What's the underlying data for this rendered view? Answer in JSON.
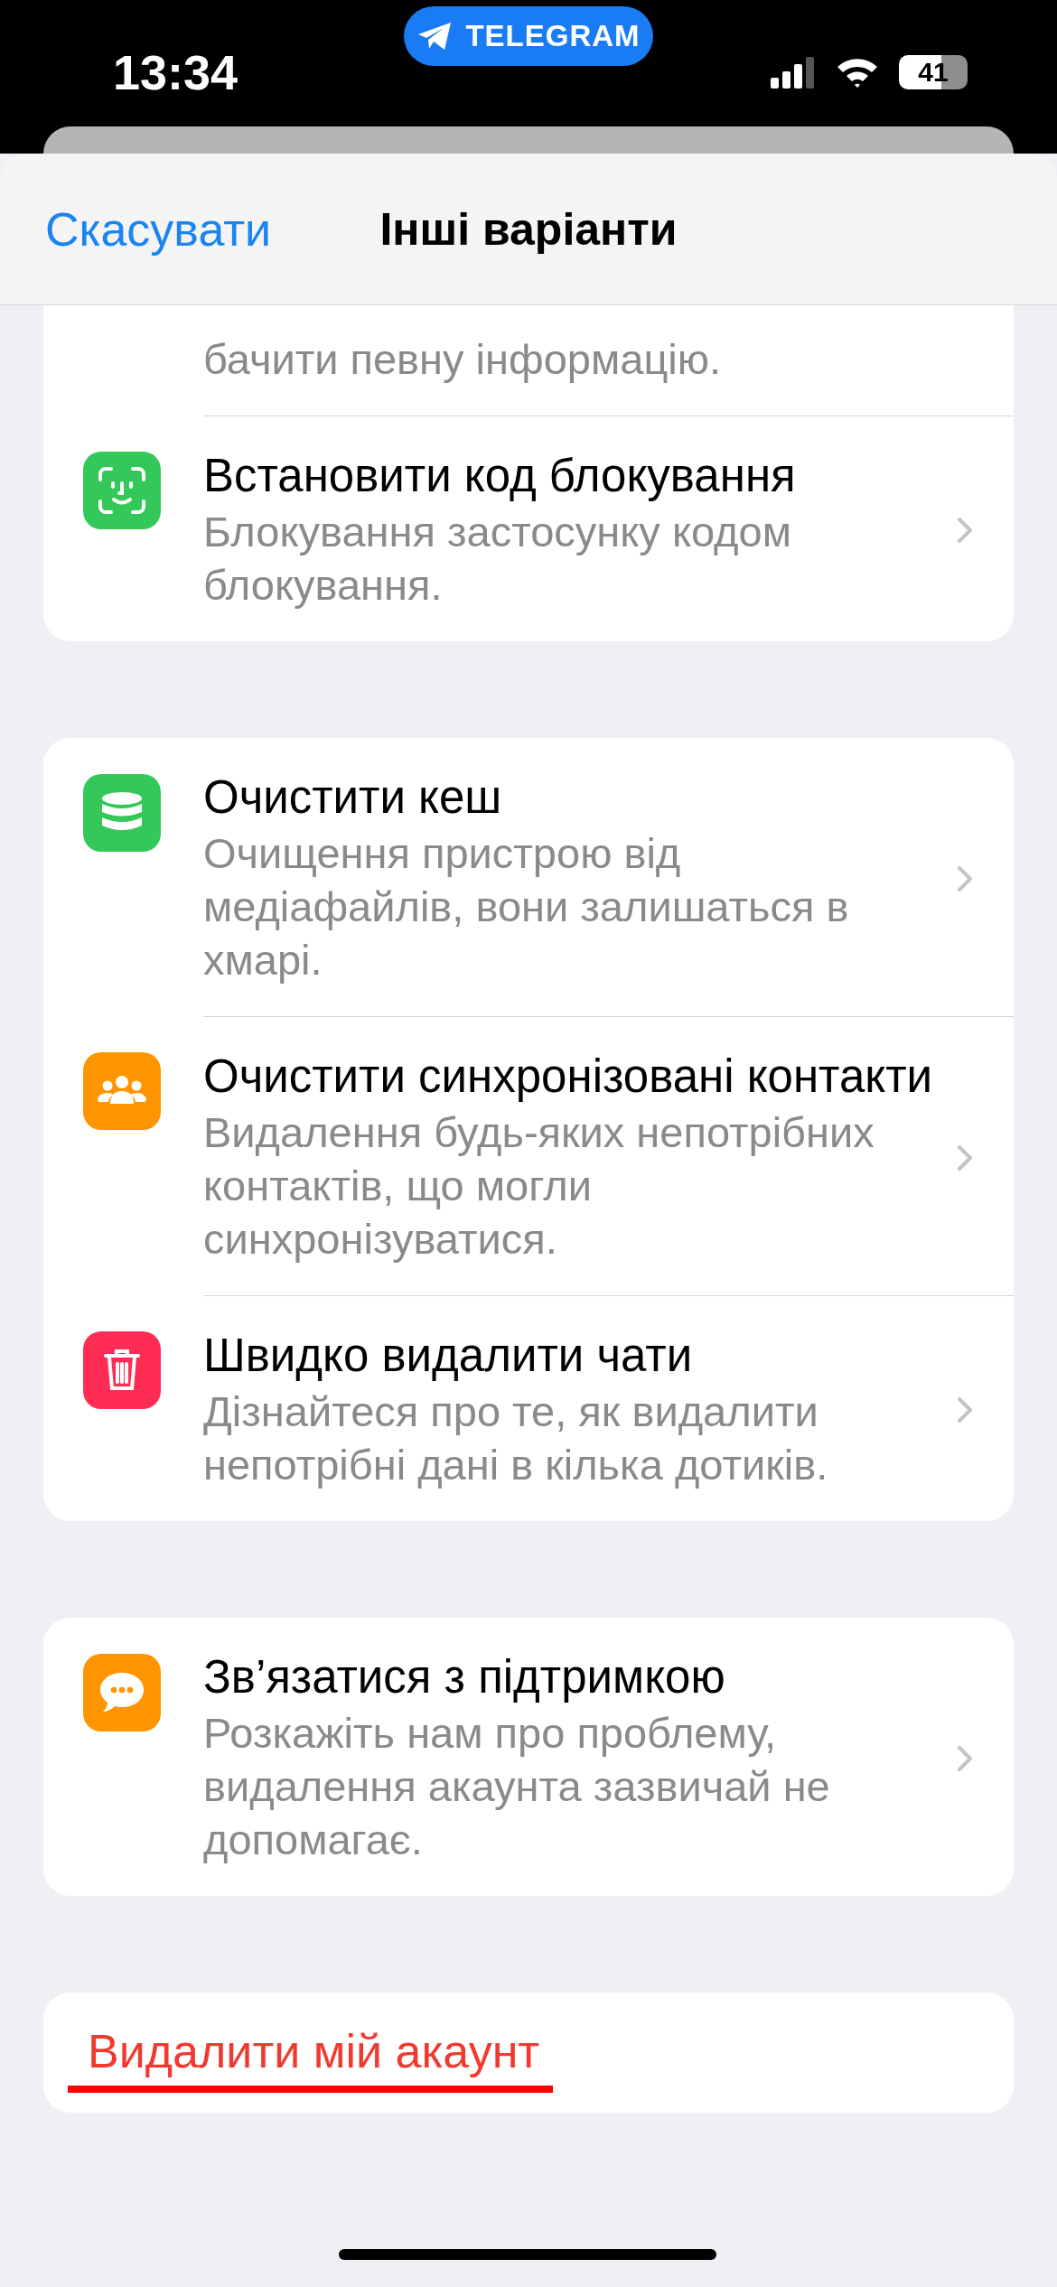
{
  "status_bar": {
    "time": "13:34",
    "app_pill": "TELEGRAM",
    "battery": "41"
  },
  "header": {
    "cancel": "Скасувати",
    "title": "Інші варіанти"
  },
  "sections": [
    {
      "cut_top": true,
      "items": [
        {
          "subtitle": "бачити певну інформацію."
        },
        {
          "kind": "face",
          "color": "#34c759",
          "title": "Встановити код блокування",
          "subtitle": "Блокування застосунку кодом блокування."
        }
      ]
    },
    {
      "cut_top": false,
      "items": [
        {
          "kind": "database",
          "color": "#34c759",
          "title": "Очистити кеш",
          "subtitle": "Очищення пристрою від медіафайлів, вони залишаться в хмарі."
        },
        {
          "kind": "people",
          "color": "#ff9500",
          "title": "Очистити синхронізовані контакти",
          "subtitle": "Видалення будь-яких непотрібних контактів, що могли синхронізуватися."
        },
        {
          "kind": "trash",
          "color": "#ff2d55",
          "title": "Швидко видалити чати",
          "subtitle": "Дізнайтеся про те, як видалити непотрібні дані в кілька дотиків."
        }
      ]
    },
    {
      "cut_top": false,
      "items": [
        {
          "kind": "chat",
          "color": "#ff9500",
          "title": "Зв’язатися з підтримкою",
          "subtitle": "Розкажіть нам про проблему, видалення акаунта зазвичай не допомагає."
        }
      ]
    }
  ],
  "action": {
    "label": "Видалити мій акаунт",
    "underlined": true
  }
}
